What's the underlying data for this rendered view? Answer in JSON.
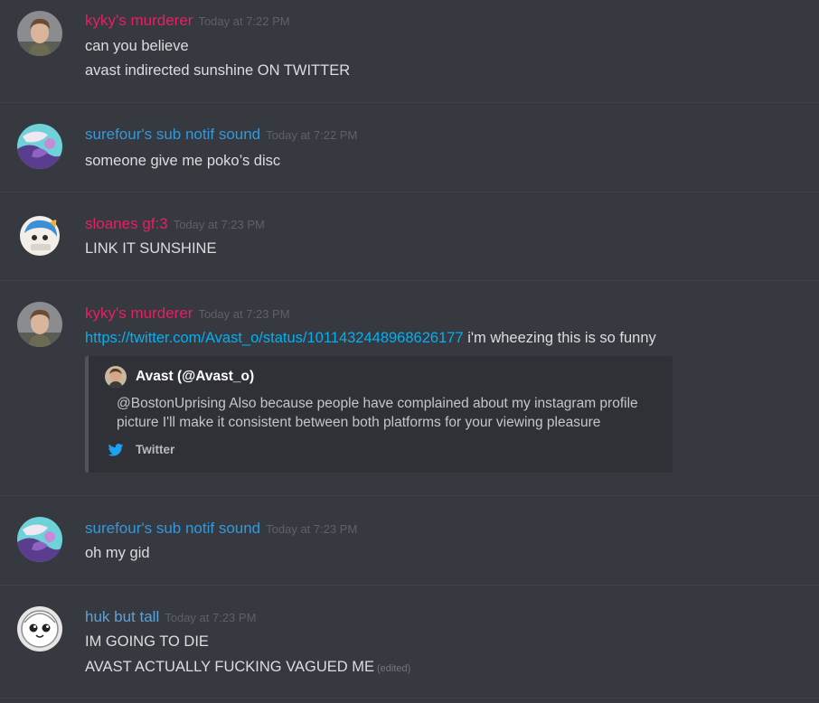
{
  "colors": {
    "background": "#36393f",
    "name_pink": "#e91e63",
    "name_blue": "#3498db",
    "name_lightblue": "#5fa0d6",
    "link": "#00b0f4",
    "embed_bg": "#2f3136",
    "twitter_blue": "#1da1f2"
  },
  "messages": [
    {
      "username": "kyky's murderer",
      "timestamp": "Today at 7:22 PM",
      "lines": [
        "can you believe",
        "avast indirected sunshine ON TWITTER"
      ]
    },
    {
      "username": "surefour's sub notif sound",
      "timestamp": "Today at 7:22 PM",
      "lines": [
        "someone give me poko’s disc"
      ]
    },
    {
      "username": "sloanes gf:3",
      "timestamp": "Today at 7:23 PM",
      "lines": [
        "LINK IT SUNSHINE"
      ]
    },
    {
      "username": "kyky's murderer",
      "timestamp": "Today at 7:23 PM",
      "link": "https://twitter.com/Avast_o/status/1011432448968626177",
      "link_suffix": " i'm wheezing this is so funny",
      "embed": {
        "author": "Avast (@Avast_o)",
        "description_line1": "@BostonUprising Also because people have complained about my instagram profile",
        "description_line2": "picture I'll make it consistent between both platforms for your viewing pleasure",
        "footer": "Twitter",
        "footer_icon": "twitter-bird-icon"
      }
    },
    {
      "username": "surefour's sub notif sound",
      "timestamp": "Today at 7:23 PM",
      "lines": [
        "oh my gid"
      ]
    },
    {
      "username": "huk but tall",
      "timestamp": "Today at 7:23 PM",
      "lines": [
        "IM GOING TO DIE",
        "AVAST ACTUALLY FUCKING VAGUED ME"
      ],
      "edited_label": "(edited)"
    }
  ]
}
